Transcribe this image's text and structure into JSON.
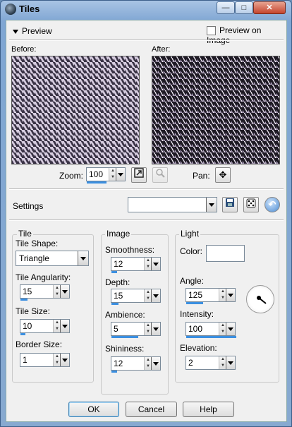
{
  "window": {
    "title": "Tiles"
  },
  "preview": {
    "toggle_label": "Preview",
    "preview_on_image_label": "Preview on Image",
    "before_label": "Before:",
    "after_label": "After:",
    "zoom_label": "Zoom:",
    "zoom_value": "100",
    "pan_label": "Pan:"
  },
  "settings": {
    "label": "Settings",
    "preset_value": ""
  },
  "tile": {
    "group_label": "Tile",
    "shape_label": "Tile Shape:",
    "shape_value": "Triangle",
    "angularity_label": "Tile Angularity:",
    "angularity_value": "15",
    "size_label": "Tile Size:",
    "size_value": "10",
    "border_label": "Border Size:",
    "border_value": "1"
  },
  "image": {
    "group_label": "Image",
    "smoothness_label": "Smoothness:",
    "smoothness_value": "12",
    "depth_label": "Depth:",
    "depth_value": "15",
    "ambience_label": "Ambience:",
    "ambience_value": "5",
    "shininess_label": "Shininess:",
    "shininess_value": "12"
  },
  "light": {
    "group_label": "Light",
    "color_label": "Color:",
    "color_value": "#ffffff",
    "angle_label": "Angle:",
    "angle_value": "125",
    "intensity_label": "Intensity:",
    "intensity_value": "100",
    "elevation_label": "Elevation:",
    "elevation_value": "2"
  },
  "buttons": {
    "ok": "OK",
    "cancel": "Cancel",
    "help": "Help"
  }
}
